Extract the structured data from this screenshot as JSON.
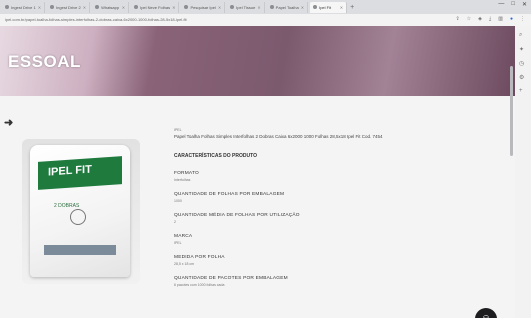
{
  "browser": {
    "tabs": [
      {
        "label": "Ingest Drive 1"
      },
      {
        "label": "Ingest Drive 2"
      },
      {
        "label": "Whatsapp"
      },
      {
        "label": "Ipel Neve Folhas"
      },
      {
        "label": "Pesquisar Ipel"
      },
      {
        "label": "Ipel Tissue"
      },
      {
        "label": "Papel Toalha"
      },
      {
        "label": "Ipel Fit"
      }
    ],
    "new_tab": "+",
    "url": "ipel.com.br/papel-toalha-folhas-simples-interfolhas-2-dobras-caixa-6x2000-1000-folhas-28-5x18-ipel-fit",
    "window_controls": [
      "—",
      "□",
      "✕"
    ]
  },
  "banner": {
    "text": "ESSOAL"
  },
  "product": {
    "brand_on_pack": "IPEL FIT",
    "pack_subtext": "2 DOBRAS"
  },
  "description": {
    "crumb": "IPEL",
    "title": "Papel Toalha Folhas Simples Interfolhas 2 Dobras Caixa 6x2000 1000 Folhas 28,5x18 Ipel Fit Cod. 7454",
    "section_title": "CARACTERÍSTICAS DO PRODUTO",
    "features": [
      {
        "label": "FORMATO",
        "value": "Interfolhas"
      },
      {
        "label": "QUANTIDADE DE FOLHAS POR EMBALAGEM",
        "value": "1000"
      },
      {
        "label": "QUANTIDADE MÉDIA DE FOLHAS POR UTILIZAÇÃO",
        "value": "2"
      },
      {
        "label": "MARCA",
        "value": "IPEL"
      },
      {
        "label": "MEDIDA POR FOLHA",
        "value": "28,5 x 18 cm"
      },
      {
        "label": "QUANTIDADE DE PACOTES POR EMBALAGEM",
        "value": "6 pacotes com 1000 folhas cada"
      }
    ]
  },
  "colors": {
    "banner_dark": "#7c5a6e",
    "pack_green": "#1f7a3e",
    "chat_button": "#1d1d1f"
  }
}
